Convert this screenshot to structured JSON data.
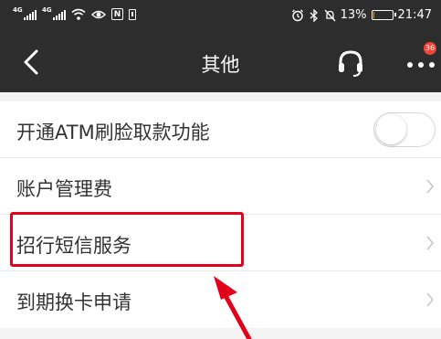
{
  "status_bar": {
    "signal_1_tag": "4G",
    "signal_2_tag": "4G",
    "nfc_label": "N",
    "battery_percent": "13%",
    "battery_level": 0.13,
    "time": "21:47"
  },
  "nav": {
    "title": "其他",
    "notification_count": "36"
  },
  "settings": {
    "items": [
      {
        "label": "开通ATM刷脸取款功能",
        "control": "toggle",
        "toggle_on": false
      },
      {
        "label": "账户管理费",
        "control": "chevron"
      },
      {
        "label": "招行短信服务",
        "control": "chevron"
      },
      {
        "label": "到期换卡申请",
        "control": "chevron"
      }
    ]
  },
  "annotation": {
    "highlight_color": "#e3001b",
    "highlighted_item": "招行短信服务"
  },
  "colors": {
    "header_bg": "#2d2d2d",
    "page_bg": "#f3f3f3",
    "badge": "#f44336",
    "battery_fill": "#ff9800"
  }
}
